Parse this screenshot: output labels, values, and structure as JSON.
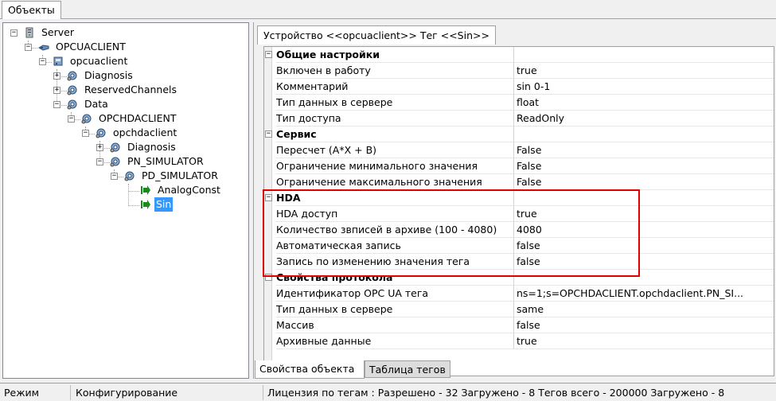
{
  "top_tab": {
    "label": "Объекты"
  },
  "tree": {
    "nodes": [
      {
        "label": "Server",
        "expander": "−",
        "icon": "server-icon"
      },
      {
        "label": "OPCUACLIENT",
        "expander": "−",
        "icon": "plug-icon"
      },
      {
        "label": "opcuaclient",
        "expander": "−",
        "icon": "device-icon"
      },
      {
        "label": "Diagnosis",
        "expander": "+",
        "icon": "folder-gear-icon"
      },
      {
        "label": "ReservedChannels",
        "expander": "+",
        "icon": "folder-gear-icon"
      },
      {
        "label": "Data",
        "expander": "−",
        "icon": "folder-gear-icon"
      },
      {
        "label": "OPCHDACLIENT",
        "expander": "−",
        "icon": "folder-gear-icon"
      },
      {
        "label": "opchdaclient",
        "expander": "−",
        "icon": "folder-gear-icon"
      },
      {
        "label": "Diagnosis",
        "expander": "+",
        "icon": "folder-gear-icon"
      },
      {
        "label": "PN_SIMULATOR",
        "expander": "−",
        "icon": "folder-gear-icon"
      },
      {
        "label": "PD_SIMULATOR",
        "expander": "−",
        "icon": "folder-gear-icon"
      },
      {
        "label": "AnalogConst",
        "expander": "",
        "icon": "tag-arrow-icon"
      },
      {
        "label": "Sin",
        "expander": "",
        "icon": "tag-arrow-icon",
        "selected": true
      }
    ]
  },
  "properties": {
    "tab_label": "Устройство <<opcuaclient>> Тег  <<Sin>>",
    "rows": [
      {
        "type": "category",
        "name": "Общие настройки",
        "value": ""
      },
      {
        "type": "prop",
        "name": "Включен в работу",
        "value": "true"
      },
      {
        "type": "prop",
        "name": "Комментарий",
        "value": "sin 0-1"
      },
      {
        "type": "prop",
        "name": "Тип данных в сервере",
        "value": "float"
      },
      {
        "type": "prop",
        "name": "Тип доступа",
        "value": "ReadOnly"
      },
      {
        "type": "category",
        "name": "Сервис",
        "value": ""
      },
      {
        "type": "prop",
        "name": "Пересчет (A*X + B)",
        "value": "False"
      },
      {
        "type": "prop",
        "name": "Ограничение минимального значения",
        "value": "False"
      },
      {
        "type": "prop",
        "name": "Ограничение максимального значения",
        "value": "False"
      },
      {
        "type": "category",
        "name": "HDA",
        "value": ""
      },
      {
        "type": "prop",
        "name": "HDA доступ",
        "value": "true"
      },
      {
        "type": "prop",
        "name": "Количество звписей в архиве (100 - 4080)",
        "value": "4080"
      },
      {
        "type": "prop",
        "name": "Автоматическая запись",
        "value": "false"
      },
      {
        "type": "prop",
        "name": "Запись по изменению значения тега",
        "value": "false"
      },
      {
        "type": "category",
        "name": "Свойства протокола",
        "value": ""
      },
      {
        "type": "prop",
        "name": "Идентификатор OPC UA тега",
        "value": "ns=1;s=OPCHDACLIENT.opchdaclient.PN_SI..."
      },
      {
        "type": "prop",
        "name": "Тип данных в сервере",
        "value": "same"
      },
      {
        "type": "prop",
        "name": "Массив",
        "value": "false"
      },
      {
        "type": "prop",
        "name": "Архивные данные",
        "value": "true"
      }
    ]
  },
  "bottom_tabs": [
    {
      "label": "Свойства объекта",
      "active": true
    },
    {
      "label": "Таблица тегов",
      "active": false
    }
  ],
  "status": {
    "mode_label": "Режим",
    "mode_value": "Конфигурирование",
    "license": "Лицензия по тегам : Разрешено - 32 Загружено - 8 Тегов всего - 200000 Загружено - 8"
  },
  "colors": {
    "selection": "#3399ff",
    "highlight_box": "#e00000",
    "tag_arrow": "#1a8a1a"
  }
}
